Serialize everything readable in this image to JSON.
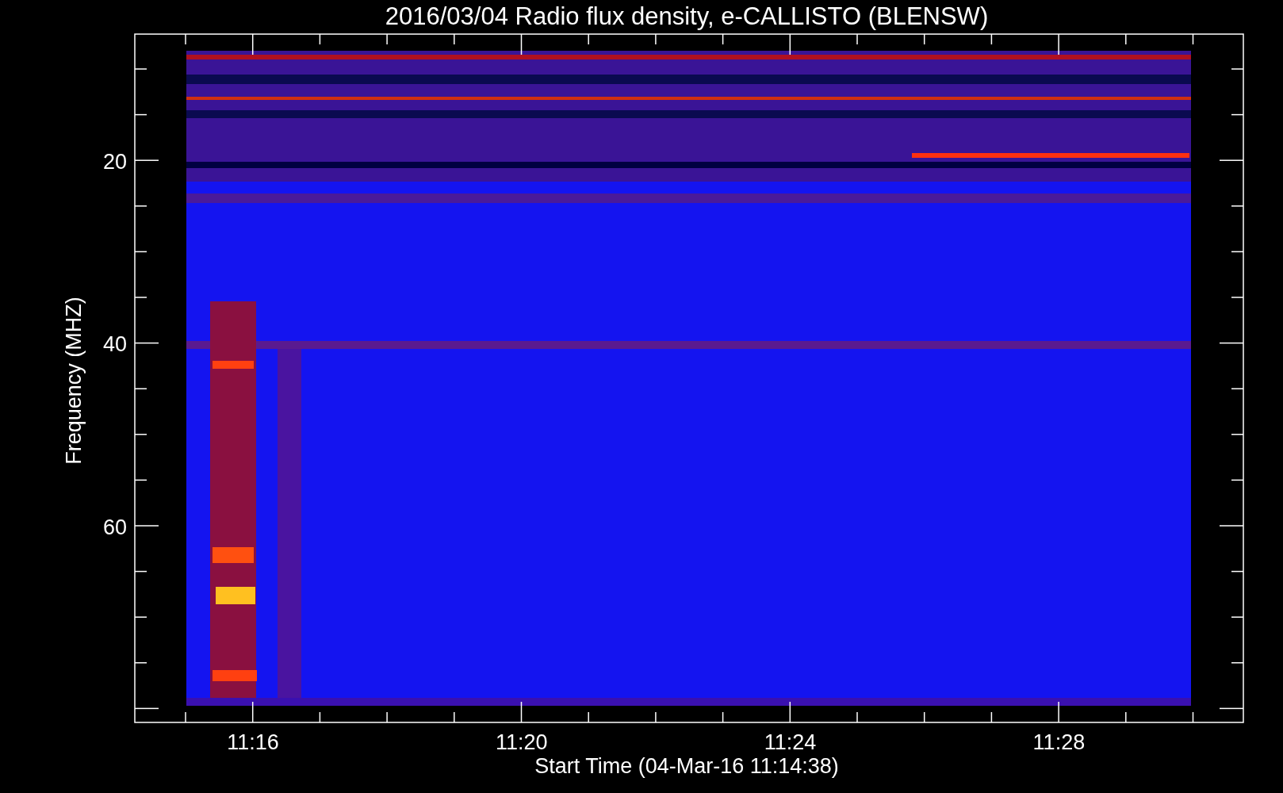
{
  "title": "2016/03/04  Radio flux density, e-CALLISTO (BLENSW)",
  "y_axis": {
    "label": "Frequency (MHZ)",
    "ticks": [
      "20",
      "40",
      "60"
    ]
  },
  "x_axis": {
    "label": "Start Time (04-Mar-16 11:14:38)",
    "ticks": [
      "11:16",
      "11:20",
      "11:24",
      "11:28"
    ]
  }
}
